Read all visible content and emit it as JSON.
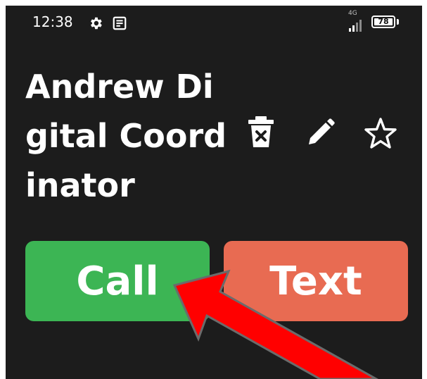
{
  "status_bar": {
    "time": "12:38",
    "network": "4G",
    "battery": "78",
    "icons": [
      "gear-icon",
      "notes-icon",
      "signal-icon",
      "battery-icon"
    ]
  },
  "contact": {
    "name": "Andrew Digital Coordinator"
  },
  "actions": {
    "icons": [
      "delete-icon",
      "edit-icon",
      "star-icon"
    ]
  },
  "buttons": {
    "call_label": "Call",
    "text_label": "Text"
  },
  "colors": {
    "background": "#1c1c1c",
    "call": "#3cb554",
    "text": "#e86b52",
    "arrow": "#ff0000"
  }
}
